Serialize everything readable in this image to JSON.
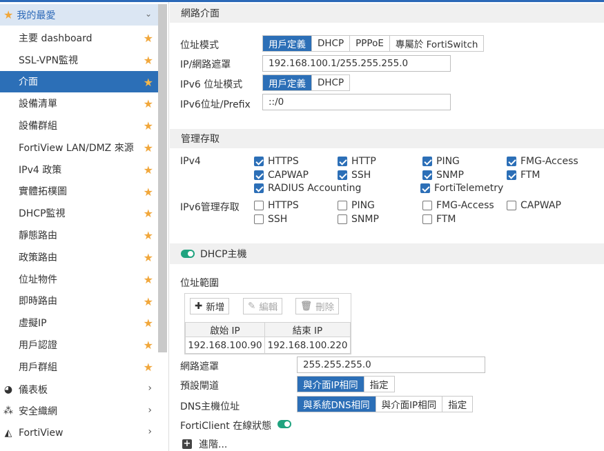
{
  "sidebar": {
    "favorites_label": "我的最愛",
    "favorites": [
      {
        "label": "主要 dashboard",
        "active": false
      },
      {
        "label": "SSL-VPN監視",
        "active": false
      },
      {
        "label": "介面",
        "active": true
      },
      {
        "label": "設備清單",
        "active": false
      },
      {
        "label": "設備群組",
        "active": false
      },
      {
        "label": "FortiView LAN/DMZ 來源",
        "active": false
      },
      {
        "label": "IPv4 政策",
        "active": false
      },
      {
        "label": "實體拓樸圖",
        "active": false
      },
      {
        "label": "DHCP監視",
        "active": false
      },
      {
        "label": "靜態路由",
        "active": false
      },
      {
        "label": "政策路由",
        "active": false
      },
      {
        "label": "位址物件",
        "active": false
      },
      {
        "label": "即時路由",
        "active": false
      },
      {
        "label": "虛擬IP",
        "active": false
      },
      {
        "label": "用戶認證",
        "active": false
      },
      {
        "label": "用戶群組",
        "active": false
      }
    ],
    "nav": [
      {
        "label": "儀表板",
        "icon": "dashboard-icon"
      },
      {
        "label": "安全織網",
        "icon": "security-fabric-icon"
      },
      {
        "label": "FortiView",
        "icon": "fortiview-chart-icon"
      }
    ]
  },
  "interface": {
    "section_title": "網路介面",
    "addr_mode_label": "位址模式",
    "addr_mode_options": [
      "用戶定義",
      "DHCP",
      "PPPoE",
      "專屬於 FortiSwitch"
    ],
    "addr_mode_selected": "用戶定義",
    "ip_mask_label": "IP/網路遮罩",
    "ip_mask_value": "192.168.100.1/255.255.255.0",
    "ipv6_mode_label": "IPv6 位址模式",
    "ipv6_mode_options": [
      "用戶定義",
      "DHCP"
    ],
    "ipv6_prefix_label": "IPv6位址/Prefix",
    "ipv6_prefix_value": "::/0"
  },
  "admin_access": {
    "section_title": "管理存取",
    "ipv4_label": "IPv4",
    "ipv4": [
      {
        "label": "HTTPS",
        "checked": true
      },
      {
        "label": "HTTP",
        "checked": true
      },
      {
        "label": "PING",
        "checked": true
      },
      {
        "label": "FMG-Access",
        "checked": true
      },
      {
        "label": "CAPWAP",
        "checked": true
      },
      {
        "label": "SSH",
        "checked": true
      },
      {
        "label": "SNMP",
        "checked": true
      },
      {
        "label": "FTM",
        "checked": true
      },
      {
        "label": "RADIUS Accounting",
        "checked": true
      },
      {
        "label": "FortiTelemetry",
        "checked": true
      }
    ],
    "ipv6_label": "IPv6管理存取",
    "ipv6": [
      {
        "label": "HTTPS",
        "checked": false
      },
      {
        "label": "PING",
        "checked": false
      },
      {
        "label": "FMG-Access",
        "checked": false
      },
      {
        "label": "CAPWAP",
        "checked": false
      },
      {
        "label": "SSH",
        "checked": false
      },
      {
        "label": "SNMP",
        "checked": false
      },
      {
        "label": "FTM",
        "checked": false
      }
    ]
  },
  "dhcp": {
    "section_title": "DHCP主機",
    "enabled": true,
    "range_label": "位址範圍",
    "add_label": "新增",
    "edit_label": "編輯",
    "delete_label": "刪除",
    "col_start": "啟始 IP",
    "col_end": "結束 IP",
    "range_start": "192.168.100.90",
    "range_end": "192.168.100.220",
    "netmask_label": "網路遮罩",
    "netmask_value": "255.255.255.0",
    "gateway_label": "預設閘道",
    "gateway_options": [
      "與介面IP相同",
      "指定"
    ],
    "dns_label": "DNS主機位址",
    "dns_options": [
      "與系統DNS相同",
      "與介面IP相同",
      "指定"
    ],
    "forticlient_label": "FortiClient 在線狀態",
    "advanced_label": "進階..."
  }
}
